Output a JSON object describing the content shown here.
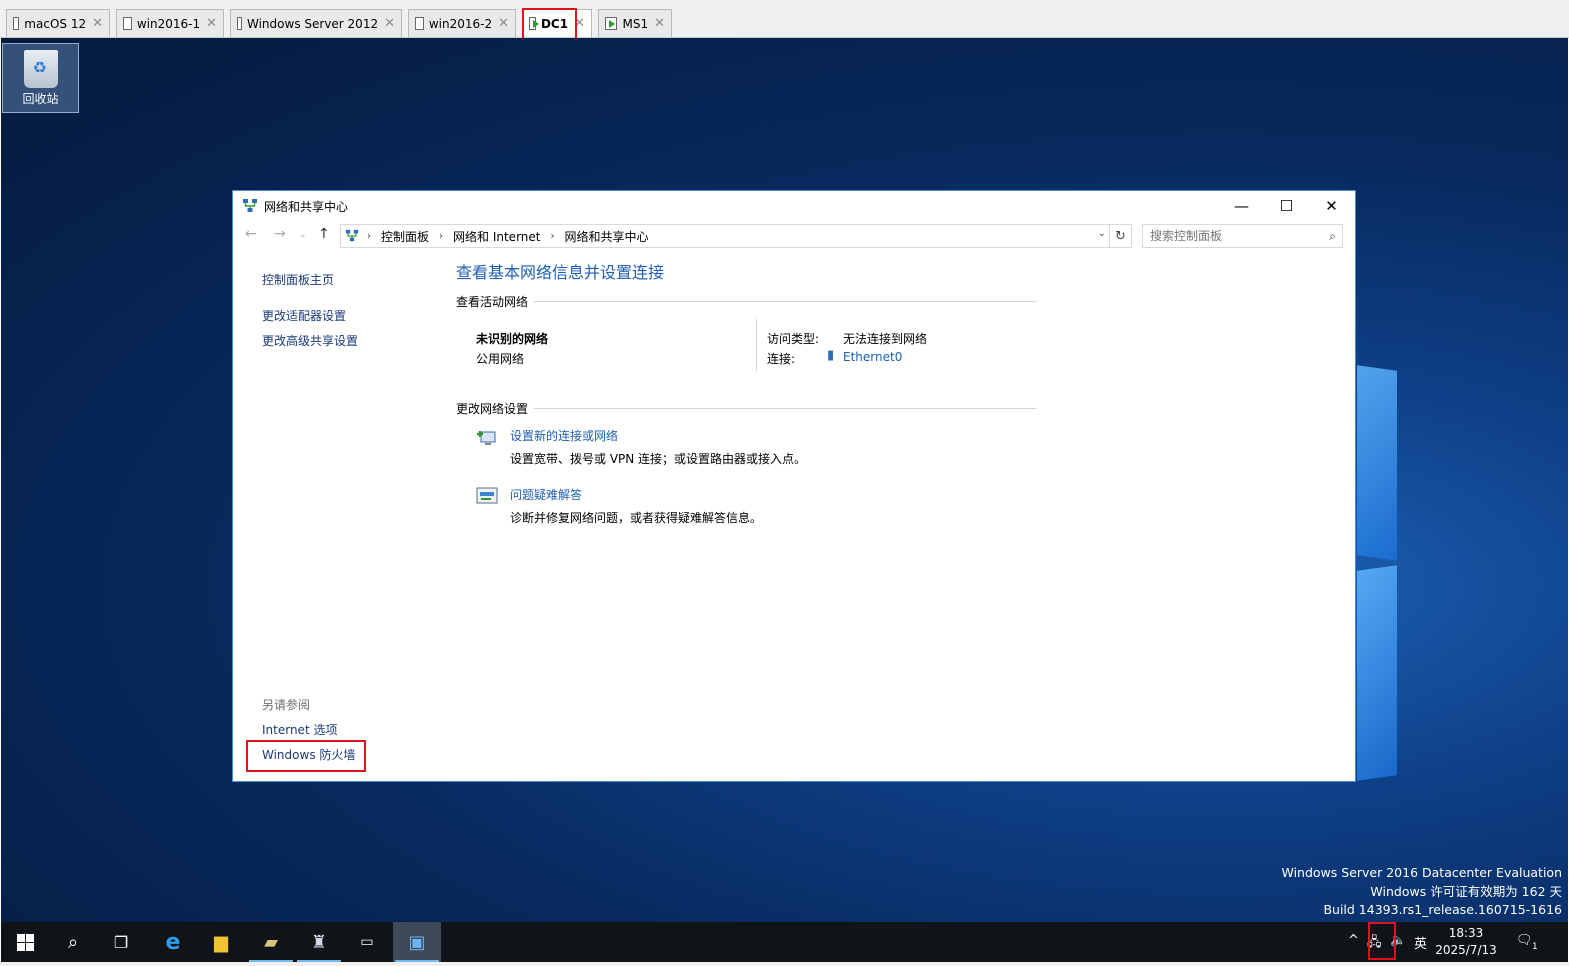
{
  "tabs": [
    {
      "label": "macOS 12",
      "running": false,
      "active": false
    },
    {
      "label": "win2016-1",
      "running": false,
      "active": false
    },
    {
      "label": "Windows Server 2012",
      "running": false,
      "active": false
    },
    {
      "label": "win2016-2",
      "running": false,
      "active": false
    },
    {
      "label": "DC1",
      "running": true,
      "active": true
    },
    {
      "label": "MS1",
      "running": true,
      "active": false
    }
  ],
  "desktop": {
    "recycle_bin_label": "回收站",
    "watermark": [
      "Windows Server 2016 Datacenter Evaluation",
      "Windows 许可证有效期为 162 天",
      "Build 14393.rs1_release.160715-1616"
    ]
  },
  "window": {
    "title": "网络和共享中心",
    "breadcrumb": [
      "控制面板",
      "网络和 Internet",
      "网络和共享中心"
    ],
    "search_placeholder": "搜索控制面板",
    "left_links": [
      "控制面板主页",
      "更改适配器设置",
      "更改高级共享设置"
    ],
    "see_also_label": "另请参阅",
    "see_also_links": [
      "Internet 选项",
      "Windows 防火墙"
    ],
    "heading": "查看基本网络信息并设置连接",
    "active_networks_header": "查看活动网络",
    "network_name": "未识别的网络",
    "network_type": "公用网络",
    "access_type_label": "访问类型:",
    "access_type_value": "无法连接到网络",
    "connection_label": "连接:",
    "connection_value": "Ethernet0",
    "change_settings_header": "更改网络设置",
    "task1_title": "设置新的连接或网络",
    "task1_desc": "设置宽带、拨号或 VPN 连接；或设置路由器或接入点。",
    "task2_title": "问题疑难解答",
    "task2_desc": "诊断并修复网络问题，或者获得疑难解答信息。"
  },
  "taskbar": {
    "ime": "英",
    "time": "18:33",
    "date": "2025/7/13",
    "notification_count": "1"
  },
  "colors": {
    "link": "#1e5fb3",
    "highlight": "#e0121b",
    "taskbar": "#101317"
  }
}
